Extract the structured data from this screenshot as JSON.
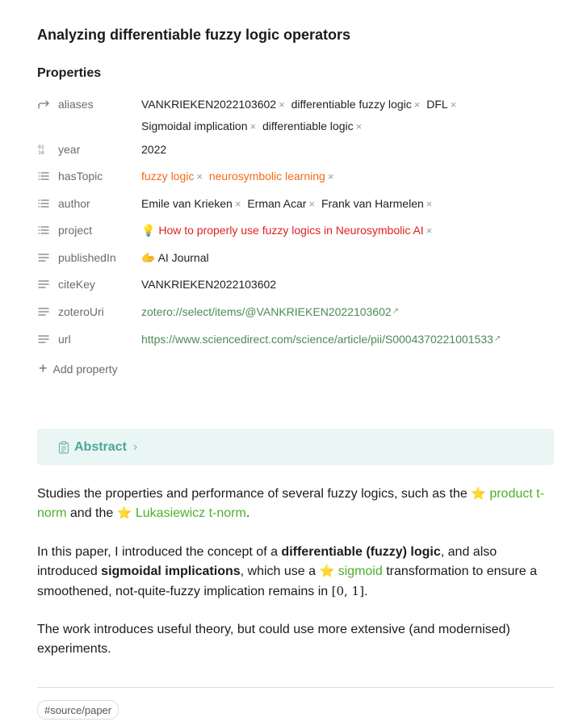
{
  "note": {
    "title": "Analyzing differentiable fuzzy logic operators",
    "properties_heading": "Properties",
    "properties": {
      "aliases": {
        "key": "aliases",
        "icon": "link-arrow-icon",
        "values": [
          "VANKRIEKEN2022103602",
          "differentiable fuzzy logic",
          "DFL",
          "Sigmoidal implication",
          "differentiable logic"
        ]
      },
      "year": {
        "key": "year",
        "icon": "number-icon",
        "value": "2022"
      },
      "hasTopic": {
        "key": "hasTopic",
        "icon": "list-icon",
        "values": [
          "fuzzy logic",
          "neurosymbolic learning"
        ]
      },
      "author": {
        "key": "author",
        "icon": "list-icon",
        "values": [
          "Emile van Krieken",
          "Erman Acar",
          "Frank van Harmelen"
        ]
      },
      "project": {
        "key": "project",
        "icon": "list-icon",
        "emoji": "💡",
        "value": "How to properly use fuzzy logics in Neurosymbolic AI"
      },
      "publishedIn": {
        "key": "publishedIn",
        "icon": "text-icon",
        "emoji": "🫱",
        "value": "AI Journal"
      },
      "citeKey": {
        "key": "citeKey",
        "icon": "text-icon",
        "value": "VANKRIEKEN2022103602"
      },
      "zoteroUri": {
        "key": "zoteroUri",
        "icon": "text-icon",
        "value": "zotero://select/items/@VANKRIEKEN2022103602"
      },
      "url": {
        "key": "url",
        "icon": "text-icon",
        "value": "https://www.sciencedirect.com/science/article/pii/S0004370221001533"
      }
    },
    "add_property": "Add property",
    "remove_glyph": "×",
    "external_glyph": "↗",
    "callout": {
      "title": "Abstract",
      "chevron": "›"
    },
    "paragraph1": {
      "t1": "Studies the properties and performance of several fuzzy logics, such as the ",
      "star": "⭐",
      "link1": "product t-norm",
      "t2": " and the ",
      "link2": "Lukasiewicz t-norm",
      "t3": "."
    },
    "paragraph2": {
      "t1": "In this paper, I introduced the concept of a ",
      "b1": "differentiable (fuzzy) logic",
      "t2": ", and also introduced ",
      "b2": "sigmoidal implications",
      "t3": ", which use a ",
      "link": "sigmoid",
      "t4": " transformation to ensure a smoothened, not-quite-fuzzy implication remains in ",
      "math": "[0, 1]",
      "t5": "."
    },
    "paragraph3": "The work introduces useful theory, but could use more extensive (and modernised) experiments.",
    "tag": "#source/paper"
  },
  "colors": {
    "topic": "#f26a1a",
    "project": "#e0201f",
    "uri_link": "#4c8a55",
    "text_link": "#4caf2a",
    "callout_bg": "#eaf6f4",
    "callout_title": "#4aa79a"
  }
}
